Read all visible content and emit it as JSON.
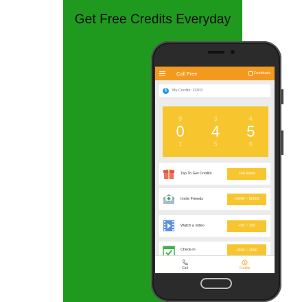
{
  "headline": "Get Free Credits Everyday",
  "app": {
    "title": "Call Free",
    "feedback_label": "Feedback"
  },
  "credits": {
    "label": "My Credits: 11303"
  },
  "slot": {
    "reels": [
      {
        "top": "9",
        "main": "0",
        "bottom": "1"
      },
      {
        "top": "3",
        "main": "4",
        "bottom": "5"
      },
      {
        "top": "4",
        "main": "5",
        "bottom": "6"
      }
    ]
  },
  "actions": [
    {
      "label": "Tap To Get Credits",
      "button": "146 times",
      "icon": "gift-icon"
    },
    {
      "label": "Invite Friends",
      "button": "+5000 ~ 50000",
      "icon": "invite-envelope-icon"
    },
    {
      "label": "Watch a video",
      "button": "+50 ~ 100",
      "icon": "video-icon"
    },
    {
      "label": "Check-in",
      "button": "+500 ~ 1500",
      "icon": "calendar-check-icon"
    }
  ],
  "nav": {
    "call_label": "Call",
    "credits_label": "Credits"
  },
  "colors": {
    "promo_background": "#1f9a1f",
    "accent_orange": "#f39a1e",
    "slot_yellow": "#f7c62f"
  }
}
